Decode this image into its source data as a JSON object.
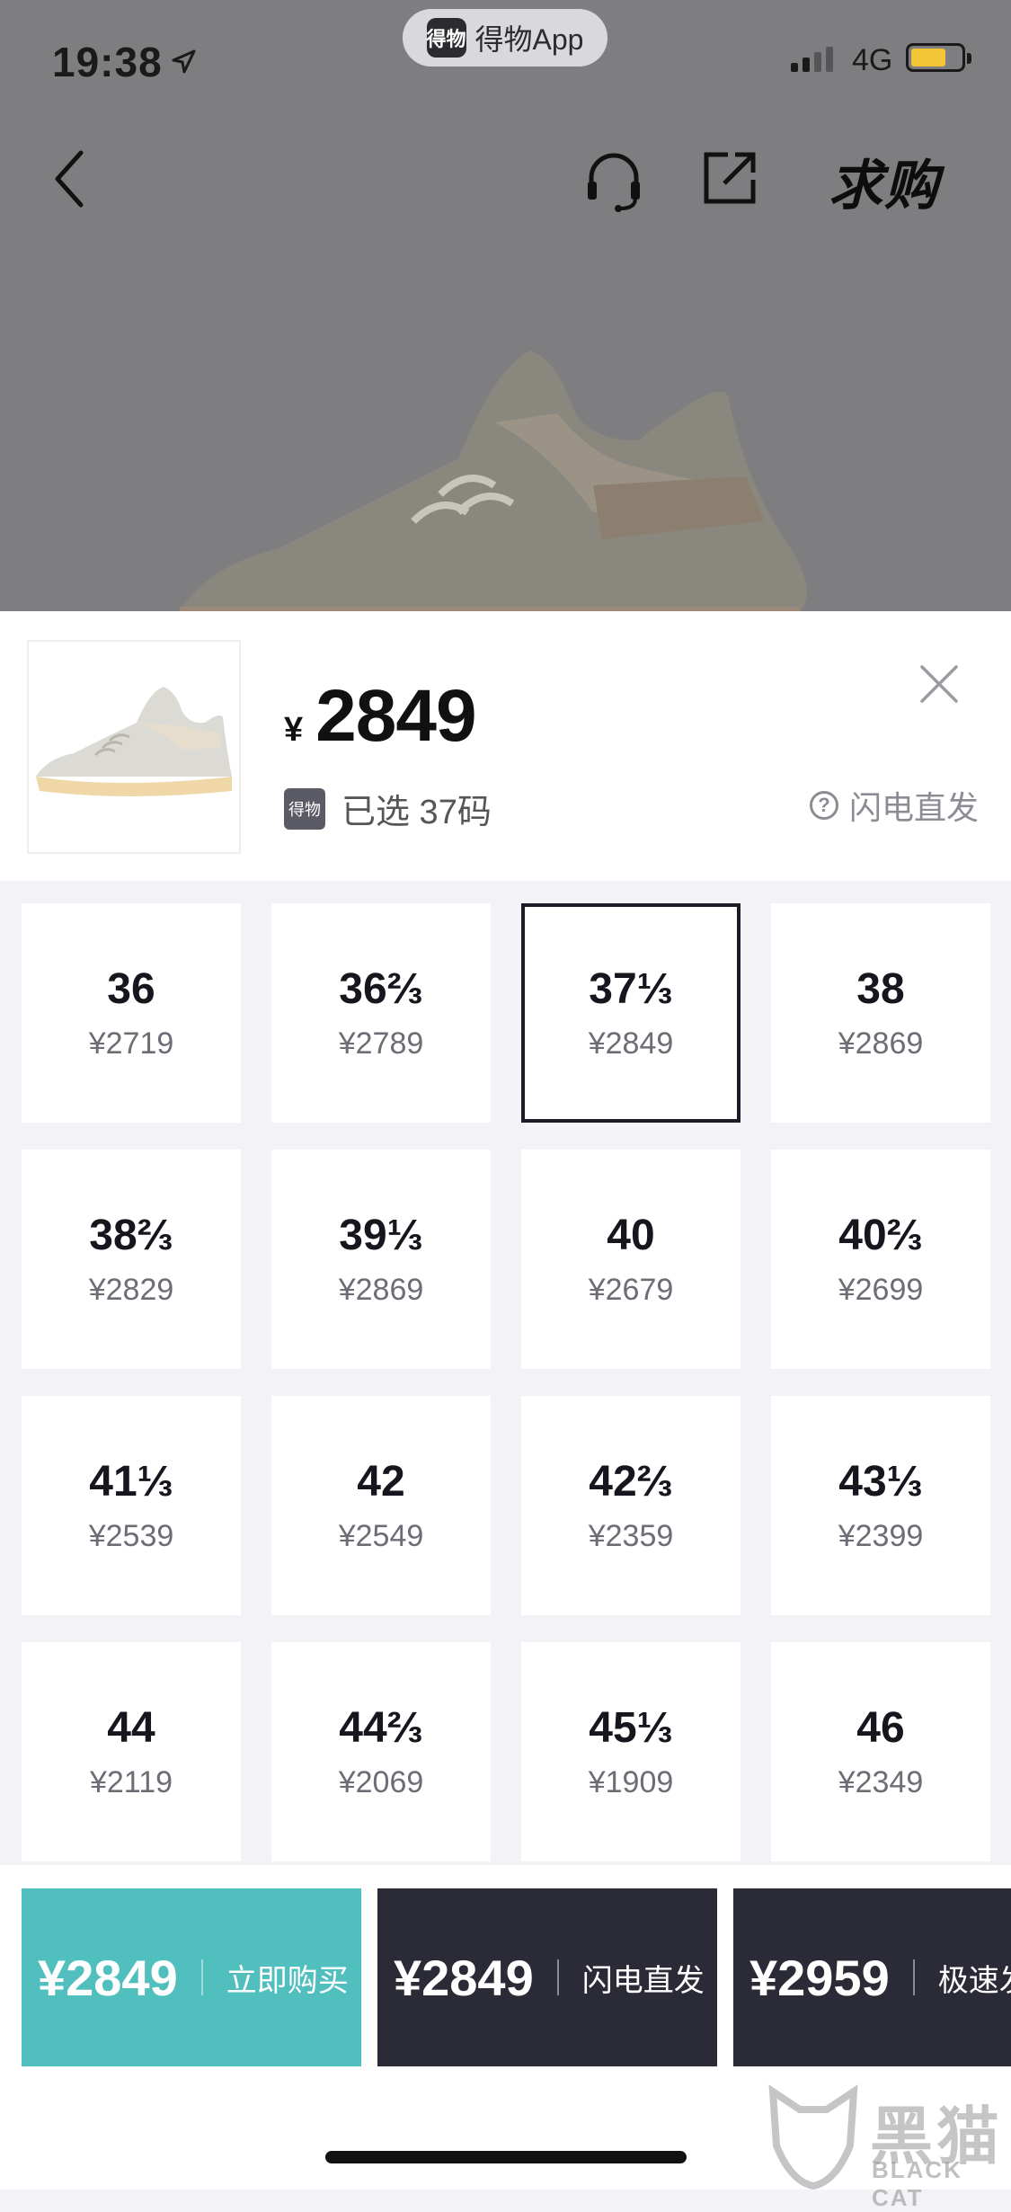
{
  "status_bar": {
    "time": "19:38",
    "app_name": "得物App",
    "app_icon_text": "得物",
    "network": "4G",
    "battery_color": "#f2c636"
  },
  "nav": {
    "back_icon": "chevron-left-icon",
    "service_icon": "headset-icon",
    "share_icon": "share-icon",
    "seek_label": "求购"
  },
  "product": {
    "currency": "¥",
    "price": "2849",
    "brand_icon_text": "得物",
    "selected_text": "已选 37码",
    "flash_label": "闪电直发"
  },
  "sizes": [
    {
      "size": "36",
      "price": "¥2719",
      "selected": false
    },
    {
      "size": "36⅔",
      "price": "¥2789",
      "selected": false
    },
    {
      "size": "37⅓",
      "price": "¥2849",
      "selected": true
    },
    {
      "size": "38",
      "price": "¥2869",
      "selected": false
    },
    {
      "size": "38⅔",
      "price": "¥2829",
      "selected": false
    },
    {
      "size": "39⅓",
      "price": "¥2869",
      "selected": false
    },
    {
      "size": "40",
      "price": "¥2679",
      "selected": false
    },
    {
      "size": "40⅔",
      "price": "¥2699",
      "selected": false
    },
    {
      "size": "41⅓",
      "price": "¥2539",
      "selected": false
    },
    {
      "size": "42",
      "price": "¥2549",
      "selected": false
    },
    {
      "size": "42⅔",
      "price": "¥2359",
      "selected": false
    },
    {
      "size": "43⅓",
      "price": "¥2399",
      "selected": false
    },
    {
      "size": "44",
      "price": "¥2119",
      "selected": false
    },
    {
      "size": "44⅔",
      "price": "¥2069",
      "selected": false
    },
    {
      "size": "45⅓",
      "price": "¥1909",
      "selected": false
    },
    {
      "size": "46",
      "price": "¥2349",
      "selected": false
    }
  ],
  "buttons": [
    {
      "price": "¥2849",
      "label": "立即购买",
      "color": "#52bfbf"
    },
    {
      "price": "¥2849",
      "label": "闪电直发",
      "color": "#2b2b37"
    },
    {
      "price": "¥2959",
      "label": "极速发",
      "color": "#2b2b37"
    }
  ],
  "watermark": {
    "cn": "黑猫",
    "en": "BLACK CAT"
  }
}
